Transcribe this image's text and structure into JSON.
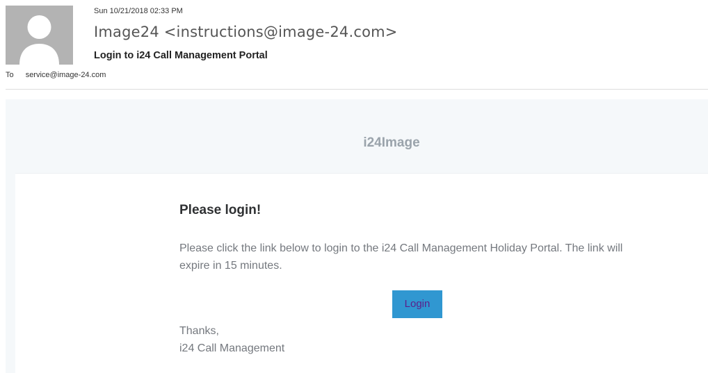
{
  "header": {
    "timestamp": "Sun 10/21/2018 02:33 PM",
    "sender": "Image24 <instructions@image-24.com>",
    "subject": "Login to i24 Call Management Portal",
    "to_label": "To",
    "to_address": "service@image-24.com"
  },
  "email": {
    "brand": "i24Image",
    "title": "Please login!",
    "body": "Please click the link below to login to the i24 Call Management Holiday Portal. The link will expire in 15 minutes.",
    "button_label": "Login",
    "thanks": "Thanks,",
    "signature": "i24 Call Management"
  },
  "colors": {
    "button_bg": "#3097d1",
    "button_text": "#5b1f8a",
    "frame_bg": "#f5f8fa",
    "avatar_bg": "#b3b3b3"
  },
  "icons": {
    "avatar": "person-silhouette-icon"
  }
}
